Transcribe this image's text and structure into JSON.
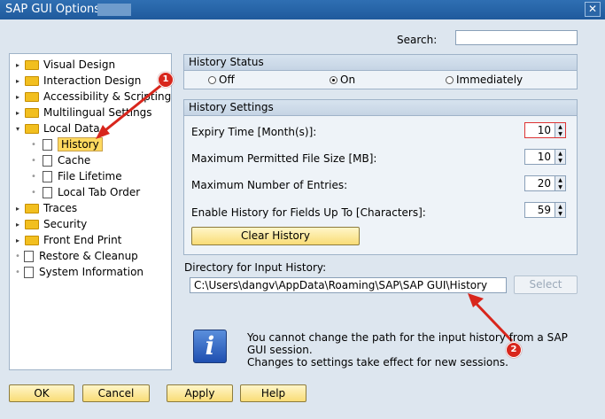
{
  "window": {
    "title": "SAP GUI Options - ",
    "close": "✕"
  },
  "search": {
    "label": "Search:",
    "value": ""
  },
  "tree": [
    {
      "label": "Visual Design",
      "kind": "folder",
      "exp": "▸"
    },
    {
      "label": "Interaction Design",
      "kind": "folder",
      "exp": "▸"
    },
    {
      "label": "Accessibility & Scripting",
      "kind": "folder",
      "exp": "▸"
    },
    {
      "label": "Multilingual Settings",
      "kind": "folder",
      "exp": "▸"
    },
    {
      "label": "Local Data",
      "kind": "folder",
      "exp": "▾"
    },
    {
      "label": "History",
      "kind": "doc",
      "selected": true
    },
    {
      "label": "Cache",
      "kind": "doc"
    },
    {
      "label": "File Lifetime",
      "kind": "doc"
    },
    {
      "label": "Local Tab Order",
      "kind": "doc"
    },
    {
      "label": "Traces",
      "kind": "folder",
      "exp": "▸"
    },
    {
      "label": "Security",
      "kind": "folder",
      "exp": "▸"
    },
    {
      "label": "Front End Print",
      "kind": "folder",
      "exp": "▸"
    },
    {
      "label": "Restore & Cleanup",
      "kind": "doc"
    },
    {
      "label": "System Information",
      "kind": "doc"
    }
  ],
  "status": {
    "heading": "History Status",
    "off": "Off",
    "on": "On",
    "immediately": "Immediately",
    "selected": "On"
  },
  "settings": {
    "heading": "History Settings",
    "fields": [
      {
        "label": "Expiry Time [Month(s)]:",
        "value": "10"
      },
      {
        "label": "Maximum Permitted File Size [MB]:",
        "value": "10"
      },
      {
        "label": "Maximum Number of Entries:",
        "value": "20"
      },
      {
        "label": "Enable History for Fields Up To [Characters]:",
        "value": "59"
      }
    ],
    "clear": "Clear History"
  },
  "directory": {
    "label": "Directory for Input History:",
    "value": "C:\\Users\\dangv\\AppData\\Roaming\\SAP\\SAP GUI\\History",
    "select": "Select"
  },
  "info": {
    "line1": "You cannot change the path for the input history from a SAP",
    "line2": "GUI session.",
    "line3": "Changes to settings take effect for new sessions."
  },
  "buttons": {
    "ok": "OK",
    "cancel": "Cancel",
    "apply": "Apply",
    "help": "Help"
  },
  "callouts": {
    "one": "1",
    "two": "2"
  },
  "colors": {
    "accent": "#1f5a9c",
    "callout": "#d8261c",
    "selection": "#ffd95f"
  }
}
